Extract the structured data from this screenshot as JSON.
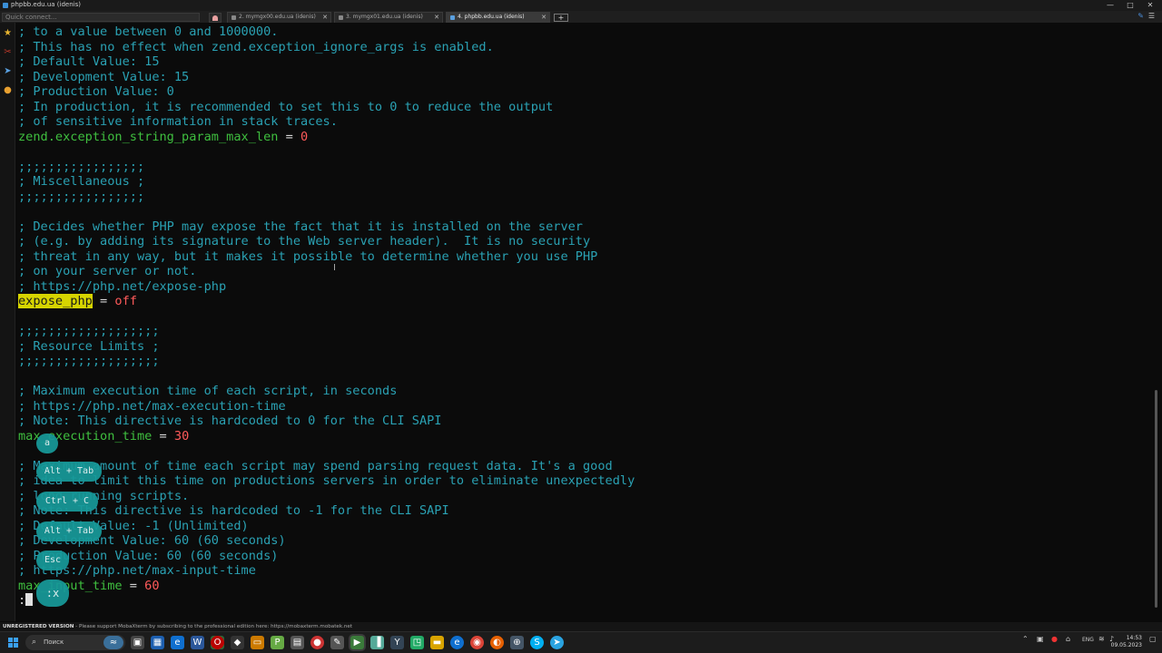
{
  "window": {
    "title": "phpbb.edu.ua (idenis)",
    "controls": [
      "—",
      "□",
      "✕"
    ]
  },
  "tabs": {
    "quick_connect_placeholder": "Quick connect...",
    "items": [
      {
        "label": "2. mymgx00.edu.ua (idenis)",
        "active": false
      },
      {
        "label": "3. mymgx01.edu.ua (idenis)",
        "active": false
      },
      {
        "label": "4. phpbb.edu.ua (idenis)",
        "active": true
      }
    ],
    "close_glyph": "✕",
    "new_tab_glyph": "+"
  },
  "terminal": {
    "lines": [
      [
        {
          "t": "; to a value between 0 and 1000000.",
          "c": "comment"
        }
      ],
      [
        {
          "t": "; This has no effect when zend.exception_ignore_args is enabled.",
          "c": "comment"
        }
      ],
      [
        {
          "t": "; Default Value: 15",
          "c": "comment"
        }
      ],
      [
        {
          "t": "; Development Value: 15",
          "c": "comment"
        }
      ],
      [
        {
          "t": "; Production Value: 0",
          "c": "comment"
        }
      ],
      [
        {
          "t": "; In production, it is recommended to set this to 0 to reduce the output",
          "c": "comment"
        }
      ],
      [
        {
          "t": "; of sensitive information in stack traces.",
          "c": "comment"
        }
      ],
      [
        {
          "t": "zend.exception_string_param_max_len",
          "c": "key"
        },
        {
          "t": " = ",
          "c": "eq"
        },
        {
          "t": "0",
          "c": "val"
        }
      ],
      [],
      [
        {
          "t": ";;;;;;;;;;;;;;;;;",
          "c": "comment"
        }
      ],
      [
        {
          "t": "; Miscellaneous ;",
          "c": "comment"
        }
      ],
      [
        {
          "t": ";;;;;;;;;;;;;;;;;",
          "c": "comment"
        }
      ],
      [],
      [
        {
          "t": "; Decides whether PHP may expose the fact that it is installed on the server",
          "c": "comment"
        }
      ],
      [
        {
          "t": "; (e.g. by adding its signature to the Web server header).  It is no security",
          "c": "comment"
        }
      ],
      [
        {
          "t": "; threat in any way, but it makes it possible to determine whether you use PHP",
          "c": "comment"
        }
      ],
      [
        {
          "t": "; on your server or not.",
          "c": "comment"
        }
      ],
      [
        {
          "t": "; https://php.net/expose-php",
          "c": "comment"
        }
      ],
      [
        {
          "t": "expose_php",
          "c": "hl"
        },
        {
          "t": " = ",
          "c": "eq"
        },
        {
          "t": "off",
          "c": "val"
        }
      ],
      [],
      [
        {
          "t": ";;;;;;;;;;;;;;;;;;;",
          "c": "comment"
        }
      ],
      [
        {
          "t": "; Resource Limits ;",
          "c": "comment"
        }
      ],
      [
        {
          "t": ";;;;;;;;;;;;;;;;;;;",
          "c": "comment"
        }
      ],
      [],
      [
        {
          "t": "; Maximum execution time of each script, in seconds",
          "c": "comment"
        }
      ],
      [
        {
          "t": "; https://php.net/max-execution-time",
          "c": "comment"
        }
      ],
      [
        {
          "t": "; Note: This directive is hardcoded to 0 for the CLI SAPI",
          "c": "comment"
        }
      ],
      [
        {
          "t": "max_execution_time",
          "c": "key"
        },
        {
          "t": " = ",
          "c": "eq"
        },
        {
          "t": "30",
          "c": "val"
        }
      ],
      [],
      [
        {
          "t": "; Maximum amount of time each script may spend parsing request data. It's a good",
          "c": "comment"
        }
      ],
      [
        {
          "t": "; idea to limit this time on productions servers in order to eliminate unexpectedly",
          "c": "comment"
        }
      ],
      [
        {
          "t": "; long running scripts.",
          "c": "comment"
        }
      ],
      [
        {
          "t": "; Note: This directive is hardcoded to -1 for the CLI SAPI",
          "c": "comment"
        }
      ],
      [
        {
          "t": "; Default Value: -1 (Unlimited)",
          "c": "comment"
        }
      ],
      [
        {
          "t": "; Development Value: 60 (60 seconds)",
          "c": "comment"
        }
      ],
      [
        {
          "t": "; Production Value: 60 (60 seconds)",
          "c": "comment"
        }
      ],
      [
        {
          "t": "; https://php.net/max-input-time",
          "c": "comment"
        }
      ],
      [
        {
          "t": "max_input_time",
          "c": "key"
        },
        {
          "t": " = ",
          "c": "eq"
        },
        {
          "t": "60",
          "c": "val"
        }
      ]
    ],
    "command_prompt": ":"
  },
  "key_overlays": [
    "a",
    "Alt + Tab",
    "Ctrl + C",
    "Alt + Tab",
    "Esc",
    ":x"
  ],
  "statusbar": {
    "unregistered": "UNREGISTERED VERSION",
    "message": "  -  Please support MobaXterm by subscribing to the professional edition here:  https://mobaxterm.mobatek.net"
  },
  "taskbar": {
    "search_label": "Поиск",
    "language": "ENG",
    "time": "14:53",
    "date": "09.05.2023"
  },
  "colors": {
    "comment": "#2aa1b3",
    "key": "#3fbf3f",
    "value": "#ff5a5a",
    "highlight": "#d6d400",
    "keycap": "#179a9a"
  }
}
